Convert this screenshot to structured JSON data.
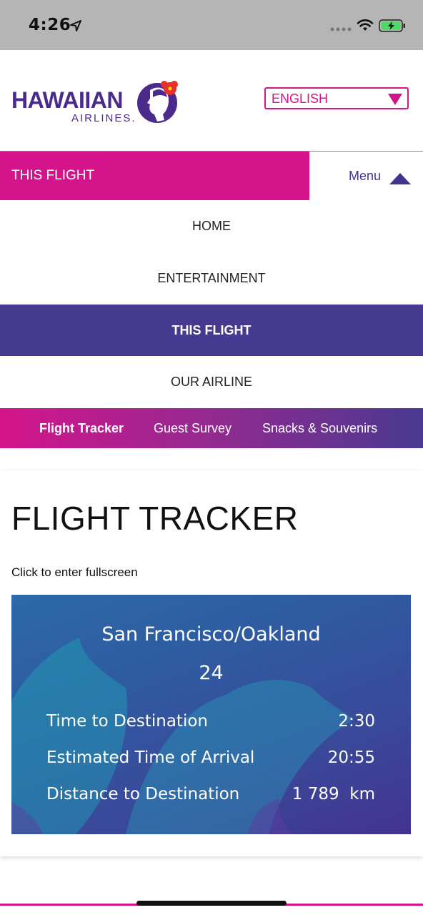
{
  "status_bar": {
    "time": "4:26",
    "icons": [
      "location-arrow-icon",
      "signal-dots-icon",
      "wifi-icon",
      "battery-charging-icon"
    ]
  },
  "header": {
    "logo_text": "HAWAIIAN",
    "logo_subtext": "AIRLINES.",
    "language": "ENGLISH"
  },
  "section_bar": {
    "current_section": "THIS FLIGHT",
    "menu_label": "Menu"
  },
  "menu": {
    "items": [
      {
        "label": "HOME",
        "active": false
      },
      {
        "label": "ENTERTAINMENT",
        "active": false
      },
      {
        "label": "THIS FLIGHT",
        "active": true
      },
      {
        "label": "OUR AIRLINE",
        "active": false
      }
    ]
  },
  "subnav": {
    "items": [
      {
        "label": "Flight Tracker",
        "active": true
      },
      {
        "label": "Guest Survey",
        "active": false
      },
      {
        "label": "Snacks & Souvenirs",
        "active": false
      }
    ]
  },
  "content": {
    "title": "FLIGHT TRACKER",
    "fullscreen_hint": "Click to enter fullscreen"
  },
  "tracker": {
    "origin": "San Francisco/Oakland",
    "flight_number": "24",
    "rows": [
      {
        "label": "Time to Destination",
        "value": "2:30"
      },
      {
        "label": "Estimated Time of Arrival",
        "value": "20:55"
      },
      {
        "label": "Distance to Destination",
        "value": "1 789  km"
      }
    ]
  },
  "colors": {
    "brand_pink": "#d4148a",
    "brand_purple": "#453a90",
    "tracker_blue": "#2c6aa8"
  }
}
